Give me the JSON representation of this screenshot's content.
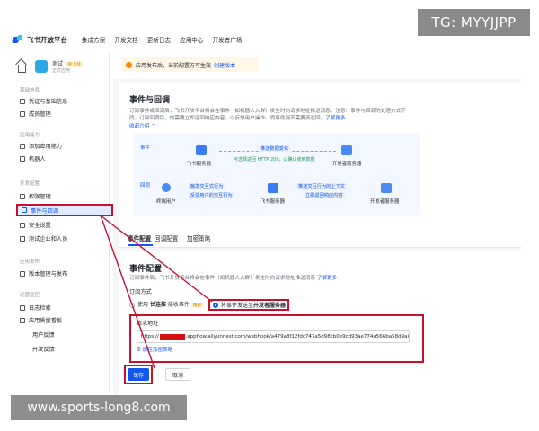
{
  "watermark_top": "TG: MYYJJPP",
  "watermark_bottom": "www.sports-long8.com",
  "topnav": {
    "brand": "飞书开放平台",
    "items": [
      "集成方案",
      "开发文档",
      "更新日志",
      "应用中心",
      "开发者广场"
    ]
  },
  "app": {
    "name": "测试",
    "version": "待上线",
    "status": "正式应用"
  },
  "notice": {
    "text": "应用发布后，当前配置方可生效",
    "link": "创建版本"
  },
  "sidebar": {
    "sec_basic": "基础信息",
    "credentials": "凭证与基础信息",
    "members": "成员管理",
    "sec_capability": "应用能力",
    "add_capability": "添加应用能力",
    "bot": "机器人",
    "sec_dev": "开发配置",
    "permission": "权限管理",
    "events": "事件与回调",
    "security": "安全设置",
    "test_tenant": "测试企业和人员",
    "sec_release": "应用发布",
    "version_mgmt": "版本管理与发布",
    "sec_ops": "运营监控",
    "logs": "日志检索",
    "quality": "应用质量看板",
    "user_feedback": "用户反馈",
    "dev_feedback": "开发反馈"
  },
  "main": {
    "title": "事件与回调",
    "desc1": "订阅事件或回调后，飞书开放平台将会在事件（如机器人入群）发生时向请求地址推送消息。注意：事件与回调的处理方式不",
    "desc2": "同，订阅回调后，你需要立即返回响应内容，以反馈用户操作。而事件则不需要该返回。",
    "desc_link": "了解更多",
    "collapse": "收起介绍 ⌃",
    "flow": {
      "event_tag": "事件",
      "callback_tag": "回调",
      "feishu_server_1": "飞书服务器",
      "dev_server_1": "开发者服务器",
      "push_change": "推送数据变化",
      "return_ok": "可选择返回 HTTP 200，以确认收到数据",
      "end_user": "终端用户",
      "feishu_server_2": "飞书服务器",
      "dev_server_2": "开发者服务器",
      "trigger": "触发交互式行为",
      "feedback": "反馈用户的交互行为",
      "push_interaction": "推送交互行为的上下文",
      "respond": "立即返回响应内容"
    }
  },
  "tabs": [
    "事件配置",
    "回调配置",
    "加密策略"
  ],
  "event_config": {
    "title": "事件配置",
    "desc": "订阅事件后，飞书开放平台将会在事件（如机器人入群）发生时向请求地址推送消息",
    "desc_link": "了解更多",
    "sub_label": "订阅方式",
    "opt1_prefix": "使用",
    "opt1_bold": "长连接",
    "opt1_suffix": "接收事件",
    "opt1_tag": "推荐",
    "opt2_prefix": "将事件发送至",
    "opt2_bold": "开发者服务器",
    "url_label": "请求地址",
    "url_prefix": "https://",
    "url_value": ".appflow.aliyunnest.com/webhook/a479a8f12fdc747a5d98cb0e9cd93ae774a566ba58d9ai",
    "encrypt_link": "前往加密策略",
    "save": "保存",
    "cancel": "取消"
  },
  "colors": {
    "accent": "#1456f0",
    "highlight": "#c8102e",
    "notice_bg": "#fff7e6"
  }
}
